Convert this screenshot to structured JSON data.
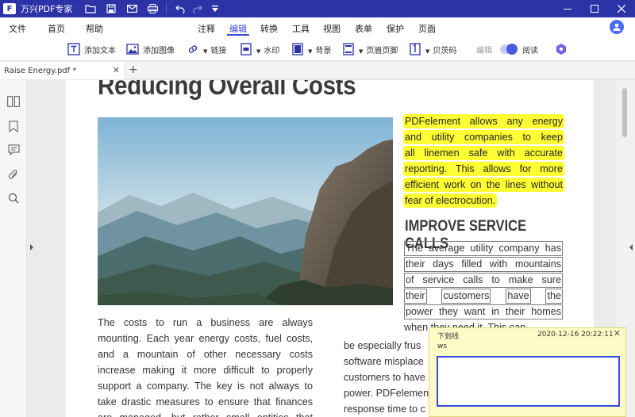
{
  "titlebar": {
    "app_name": "万兴PDF专家",
    "logo_letter": "F"
  },
  "menu": {
    "left": [
      "文件",
      "首页",
      "帮助"
    ],
    "center": [
      "注释",
      "编辑",
      "转换",
      "工具",
      "视图",
      "表单",
      "保护",
      "页面"
    ],
    "active": "编辑"
  },
  "toolbar": {
    "add_text": "添加文本",
    "add_image": "添加图像",
    "link": "链接",
    "watermark": "水印",
    "background": "背景",
    "header_footer": "页眉页脚",
    "bates": "贝茨码",
    "edit": "编辑",
    "read": "阅读"
  },
  "tabs": [
    {
      "label": "Raise Energy.pdf *"
    }
  ],
  "document": {
    "heading": "Reducing Overall Costs",
    "highlighted_lines": [
      "PDFelement allows any energy",
      "and utility companies to keep",
      "all linemen safe with accurate",
      "reporting. This allows for more",
      "efficient work on the lines without",
      "fear of electrocution."
    ],
    "subheading": "IMPROVE SERVICE CALLS",
    "boxed_lines": [
      [
        "The average utility company has"
      ],
      [
        "their days filled with mountains"
      ],
      [
        "of service calls to make sure"
      ],
      [
        "their",
        "customers",
        "have",
        "the"
      ],
      [
        "power they want in their homes"
      ]
    ],
    "partial_line_behind": "when they need it. This can",
    "column1": [
      "The costs to run a business are always",
      "mounting. Each year energy costs, fuel costs,",
      "and a mountain of other necessary costs",
      "increase making it more difficult to properly",
      "support a company. The key is not always to",
      "take drastic measures to ensure that finances",
      "are managed, but rather small entities that"
    ],
    "column2": [
      "be especially frus",
      "software misplace",
      "customers to have",
      "power. PDFelemen",
      "response time to c"
    ]
  },
  "note": {
    "title": "下划线",
    "datetime": "2020-12-16 20:22:11",
    "author": "ws",
    "content": ""
  },
  "colors": {
    "titlebar": "#2b33a6",
    "accent": "#3a49d8",
    "highlight": "#ffff33",
    "note_bg": "#fffbc6"
  }
}
